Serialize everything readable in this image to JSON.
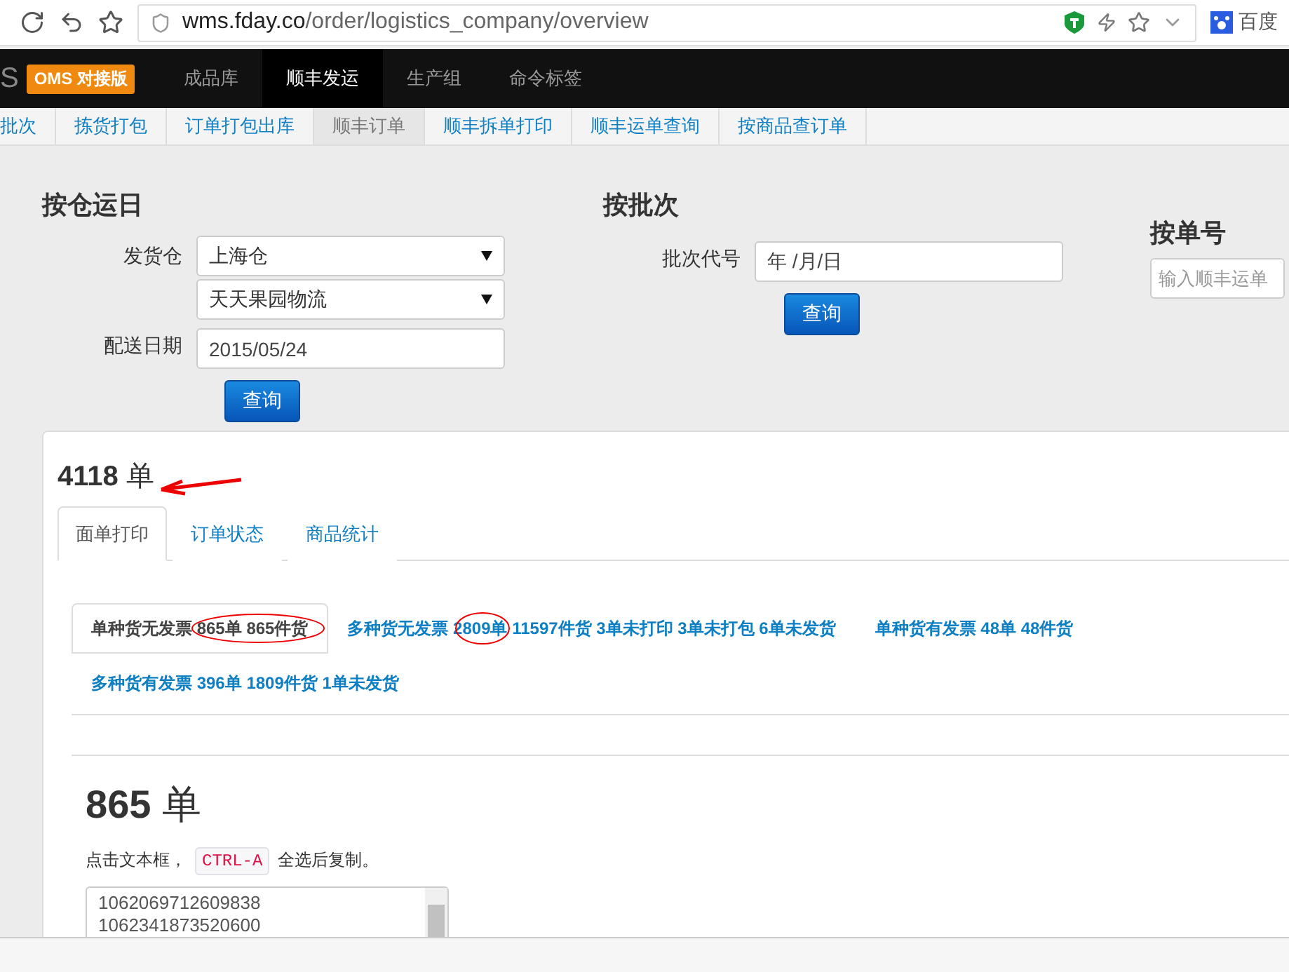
{
  "browser": {
    "url_host": "wms.fday.co",
    "url_path": "/order/logistics_company/overview",
    "search_engine": "百度"
  },
  "navbar": {
    "brand": "S",
    "badge": "OMS 对接版",
    "items": [
      {
        "label": "成品库",
        "selected": false
      },
      {
        "label": "顺丰发运",
        "selected": true
      },
      {
        "label": "生产组",
        "selected": false
      },
      {
        "label": "命令标签",
        "selected": false
      }
    ]
  },
  "subnav": [
    {
      "label": "批次",
      "selected": false
    },
    {
      "label": "拣货打包",
      "selected": false
    },
    {
      "label": "订单打包出库",
      "selected": false
    },
    {
      "label": "顺丰订单",
      "selected": true
    },
    {
      "label": "顺丰拆单打印",
      "selected": false
    },
    {
      "label": "顺丰运单查询",
      "selected": false
    },
    {
      "label": "按商品查订单",
      "selected": false
    }
  ],
  "by_warehouse": {
    "title": "按仓运日",
    "warehouse_label": "发货仓",
    "warehouse": "上海仓",
    "carrier": "天天果园物流",
    "date_label": "配送日期",
    "date": "2015/05/24",
    "button": "查询"
  },
  "by_batch": {
    "title": "按批次",
    "batch_label": "批次代号",
    "batch_value": "年 /月/日",
    "button": "查询"
  },
  "by_number": {
    "title": "按单号",
    "placeholder": "输入顺丰运单"
  },
  "summary": {
    "count": "4118",
    "unit": "单"
  },
  "tabs": [
    {
      "label": "面单打印",
      "selected": true
    },
    {
      "label": "订单状态",
      "selected": false
    },
    {
      "label": "商品统计",
      "selected": false
    }
  ],
  "pills": [
    {
      "label": "单种货无发票 865单 865件货",
      "selected": true
    },
    {
      "label": "多种货无发票 2809单 11597件货 3单未打印 3单未打包 6单未发货",
      "selected": false
    },
    {
      "label": "单种货有发票 48单 48件货",
      "selected": false
    },
    {
      "label": "多种货有发票 396单 1809件货 1单未发货",
      "selected": false
    }
  ],
  "result": {
    "count": "865",
    "unit": "单",
    "hint_before": "点击文本框，",
    "key": "CTRL-A",
    "hint_after": "全选后复制。",
    "lines": [
      "1062069712609838",
      "1062341873520600"
    ]
  }
}
